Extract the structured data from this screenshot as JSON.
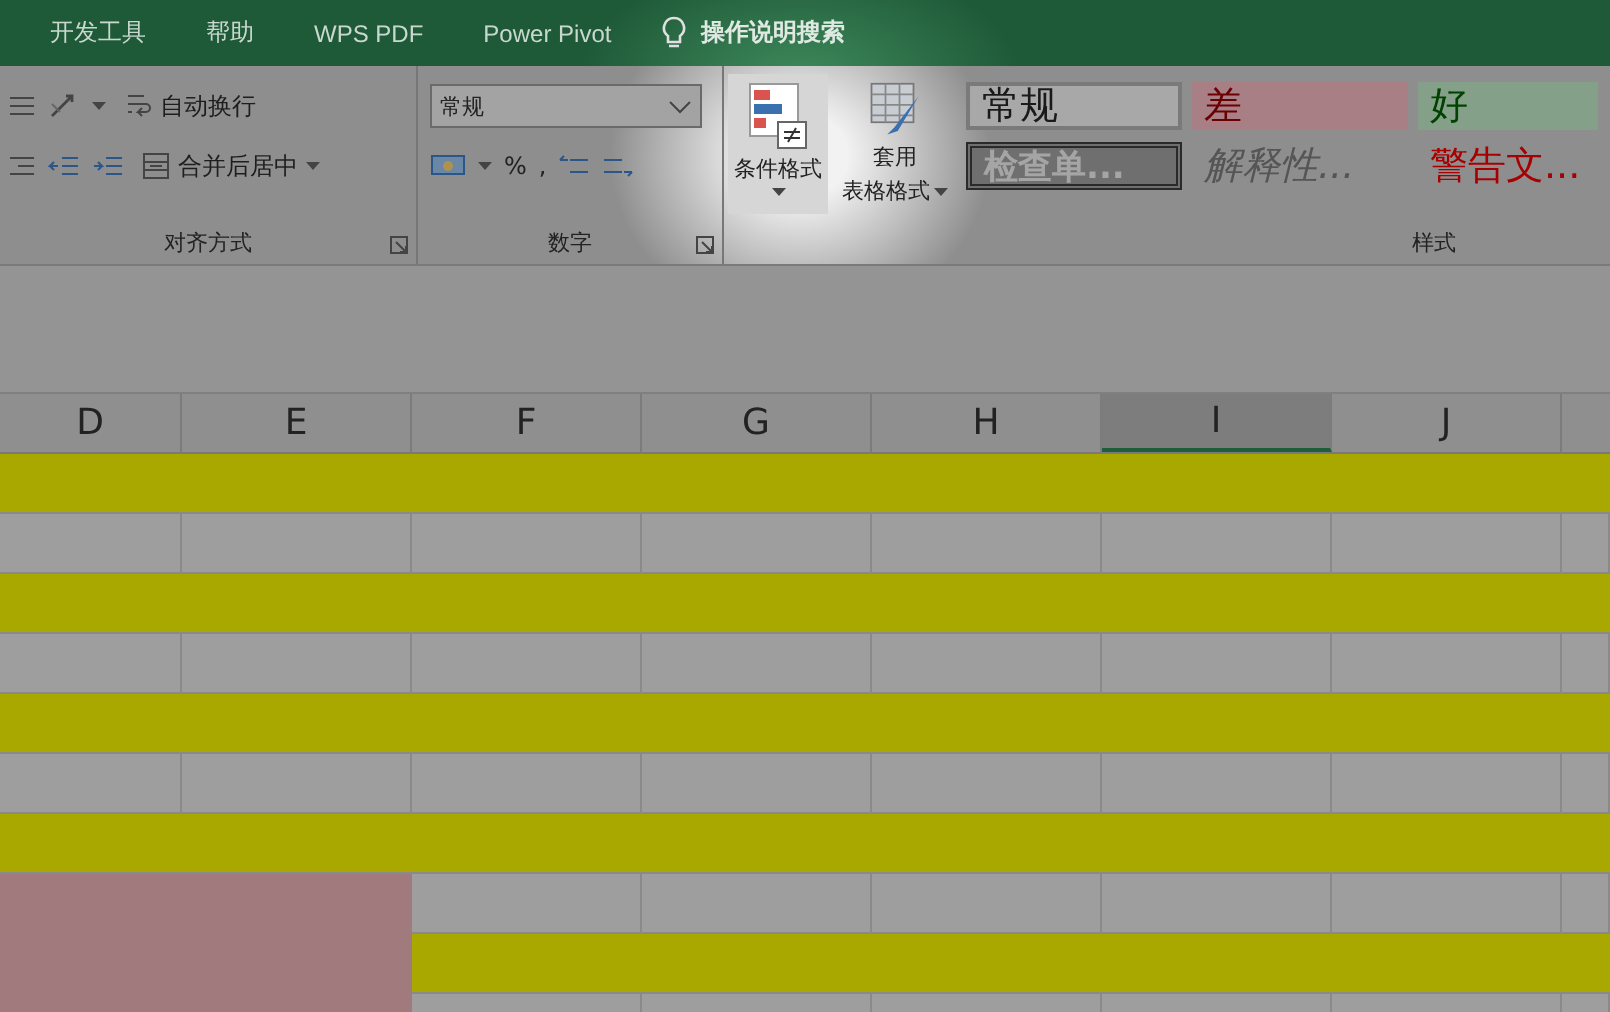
{
  "tabs": [
    {
      "label": "开发工具"
    },
    {
      "label": "帮助"
    },
    {
      "label": "WPS PDF"
    },
    {
      "label": "Power Pivot"
    }
  ],
  "tell_me": {
    "label": "操作说明搜索"
  },
  "alignment_group": {
    "wrap_text": "自动换行",
    "merge_center": "合并后居中",
    "label": "对齐方式"
  },
  "number_group": {
    "format_value": "常规",
    "percent": "%",
    "comma": ",",
    "label": "数字"
  },
  "conditional_format": {
    "label": "条件格式",
    "selected": true
  },
  "format_as_table": {
    "lines": [
      "套用",
      "表格格式"
    ]
  },
  "cell_styles": [
    {
      "label": "常规",
      "kind": "normal"
    },
    {
      "label": "差",
      "kind": "bad"
    },
    {
      "label": "好",
      "kind": "good"
    },
    {
      "label": "检查单...",
      "kind": "check"
    },
    {
      "label": "解释性...",
      "kind": "explanatory"
    },
    {
      "label": "警告文...",
      "kind": "warning"
    }
  ],
  "styles_label": "样式",
  "columns": [
    {
      "label": "D",
      "selected": false
    },
    {
      "label": "E",
      "selected": false
    },
    {
      "label": "F",
      "selected": false
    },
    {
      "label": "G",
      "selected": false
    },
    {
      "label": "H",
      "selected": false
    },
    {
      "label": "I",
      "selected": true
    },
    {
      "label": "J",
      "selected": false
    }
  ],
  "rows": [
    {
      "color": "#a8a800"
    },
    {},
    {
      "color": "#a8a800"
    },
    {},
    {
      "color": "#a8a800"
    },
    {},
    {
      "color": "#a8a800"
    },
    {
      "merged": true
    },
    {
      "color": "#a8a800",
      "merged": true
    },
    {
      "merged": true
    }
  ],
  "merged_cell": {
    "color": "#a07a7c"
  }
}
